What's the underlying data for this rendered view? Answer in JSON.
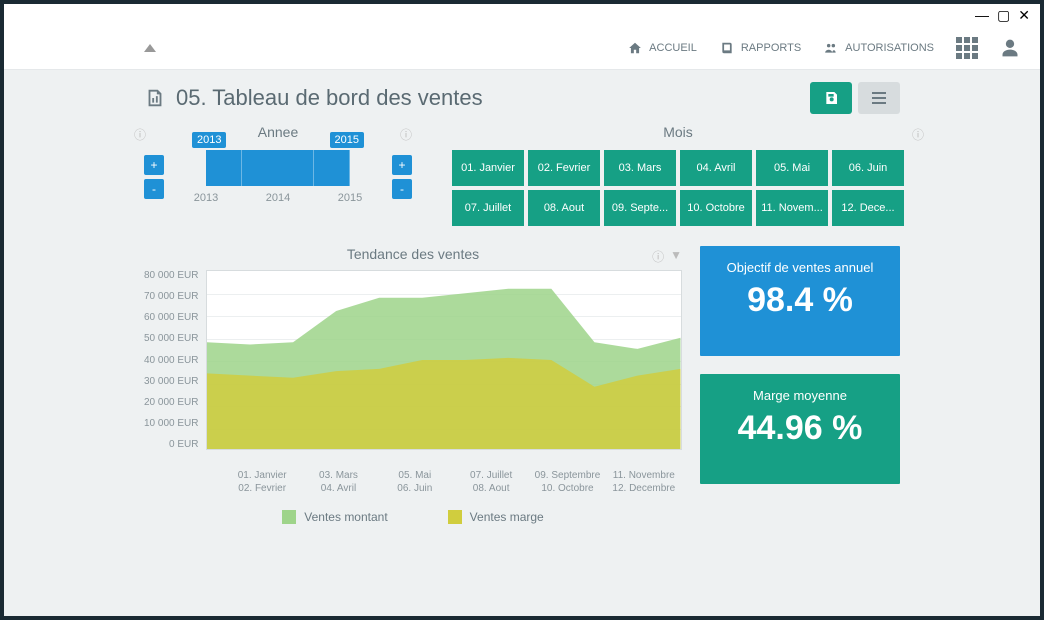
{
  "nav": {
    "home": "ACCUEIL",
    "reports": "RAPPORTS",
    "auth": "AUTORISATIONS"
  },
  "page": {
    "title": "05. Tableau de bord des ventes"
  },
  "filters": {
    "year_label": "Annee",
    "year_start": "2013",
    "year_end": "2015",
    "years": [
      "2013",
      "2014",
      "2015"
    ],
    "plus": "+",
    "minus": "-",
    "month_label": "Mois",
    "months": [
      "01. Janvier",
      "02. Fevrier",
      "03. Mars",
      "04. Avril",
      "05. Mai",
      "06. Juin",
      "07. Juillet",
      "08. Aout",
      "09. Septe...",
      "10. Octobre",
      "11. Novem...",
      "12. Dece..."
    ]
  },
  "chart": {
    "title": "Tendance des ventes",
    "yticks": [
      "80 000 EUR",
      "70 000 EUR",
      "60 000 EUR",
      "50 000 EUR",
      "40 000 EUR",
      "30 000 EUR",
      "20 000 EUR",
      "10 000 EUR",
      "0 EUR"
    ],
    "xrow1": [
      "01. Janvier",
      "03. Mars",
      "05. Mai",
      "07. Juillet",
      "09. Septembre",
      "11. Novembre"
    ],
    "xrow2": [
      "02. Fevrier",
      "04. Avril",
      "06. Juin",
      "08. Aout",
      "10. Octobre",
      "12. Decembre"
    ],
    "legend1": "Ventes montant",
    "legend2": "Ventes marge"
  },
  "kpi": {
    "objective_label": "Objectif de ventes annuel",
    "objective_value": "98.4 %",
    "margin_label": "Marge moyenne",
    "margin_value": "44.96 %"
  },
  "chart_data": {
    "type": "area",
    "title": "Tendance des ventes",
    "xlabel": "",
    "ylabel": "EUR",
    "ylim": [
      0,
      80000
    ],
    "categories": [
      "01. Janvier",
      "02. Fevrier",
      "03. Mars",
      "04. Avril",
      "05. Mai",
      "06. Juin",
      "07. Juillet",
      "08. Aout",
      "09. Septembre",
      "10. Octobre",
      "11. Novembre",
      "12. Decembre"
    ],
    "series": [
      {
        "name": "Ventes montant",
        "color": "#9ed48a",
        "values": [
          48000,
          47000,
          48000,
          62000,
          68000,
          68000,
          70000,
          72000,
          72000,
          48000,
          45000,
          50000
        ]
      },
      {
        "name": "Ventes marge",
        "color": "#d0cd3e",
        "values": [
          34000,
          33000,
          32000,
          35000,
          36000,
          40000,
          40000,
          41000,
          40000,
          28000,
          33000,
          36000
        ]
      }
    ]
  }
}
